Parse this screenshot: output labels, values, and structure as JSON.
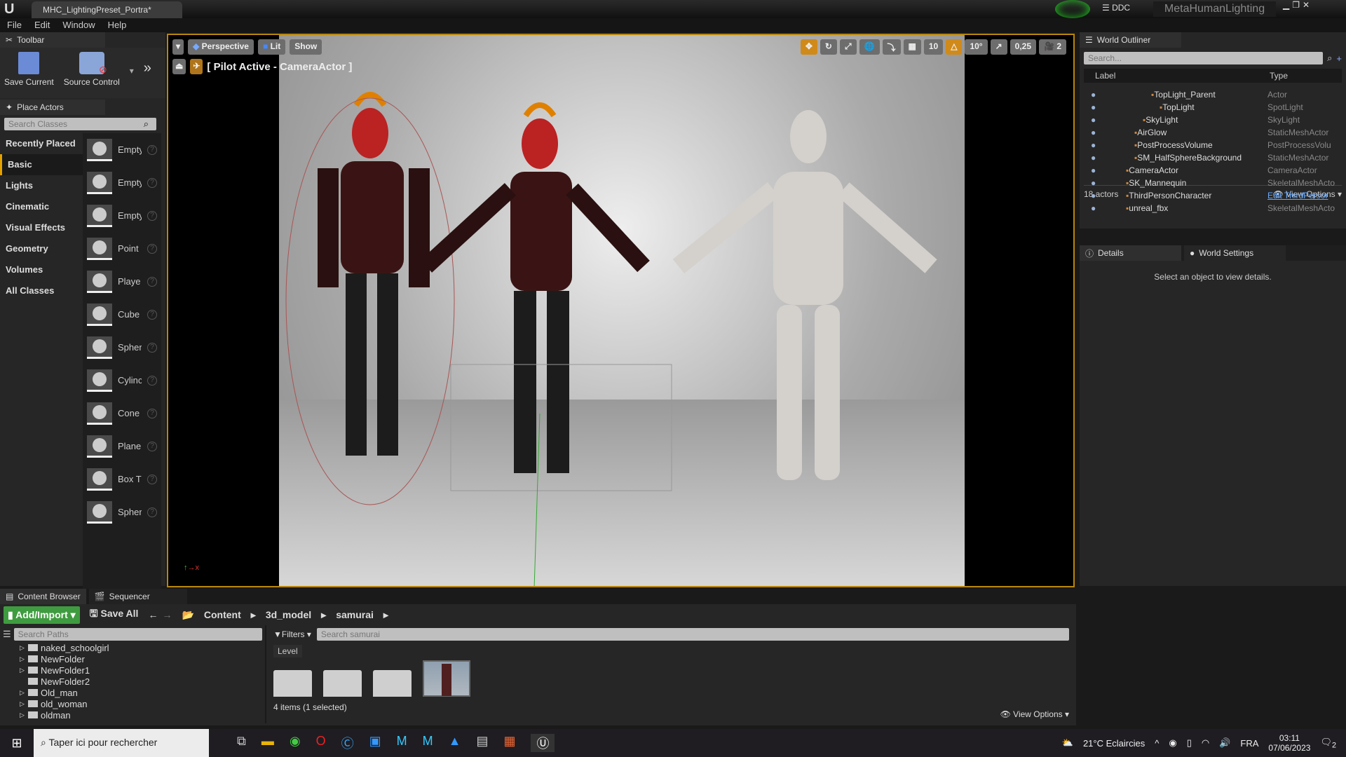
{
  "window": {
    "tab_title": "MHC_LightingPreset_Portra*",
    "ddc_label": "DDC",
    "project_name": "MetaHumanLighting"
  },
  "menu": [
    "File",
    "Edit",
    "Window",
    "Help"
  ],
  "toolbar": {
    "tab": "Toolbar",
    "save": "Save Current",
    "source_control": "Source Control"
  },
  "place_actors": {
    "tab": "Place Actors",
    "search_placeholder": "Search Classes",
    "categories": [
      "Recently Placed",
      "Basic",
      "Lights",
      "Cinematic",
      "Visual Effects",
      "Geometry",
      "Volumes",
      "All Classes"
    ],
    "items": [
      "Empty",
      "Empty",
      "Empty",
      "Point",
      "Playe",
      "Cube",
      "Spher",
      "Cylinc",
      "Cone",
      "Plane",
      "Box T",
      "Spher"
    ]
  },
  "viewport": {
    "view_mode": "Perspective",
    "lit": "Lit",
    "show": "Show",
    "pilot_label": "[ Pilot Active - CameraActor ]",
    "grid_snap": "10",
    "rot_snap": "10°",
    "scale_snap": "0,25",
    "camera_speed": "2"
  },
  "outliner": {
    "tab": "World Outliner",
    "search_placeholder": "Search...",
    "col_label": "Label",
    "col_type": "Type",
    "rows": [
      {
        "label": "TopLight_Parent",
        "type": "Actor",
        "indent": 3
      },
      {
        "label": "TopLight",
        "type": "SpotLight",
        "indent": 4
      },
      {
        "label": "SkyLight",
        "type": "SkyLight",
        "indent": 2
      },
      {
        "label": "AirGlow",
        "type": "StaticMeshActor",
        "indent": 1
      },
      {
        "label": "PostProcessVolume",
        "type": "PostProcessVolu",
        "indent": 1
      },
      {
        "label": "SM_HalfSphereBackground",
        "type": "StaticMeshActor",
        "indent": 1
      },
      {
        "label": "CameraActor",
        "type": "CameraActor",
        "indent": 0
      },
      {
        "label": "SK_Mannequin",
        "type": "SkeletalMeshActo",
        "indent": 0
      },
      {
        "label": "ThirdPersonCharacter",
        "type": "Edit ThirdPersor",
        "indent": 0
      },
      {
        "label": "unreal_fbx",
        "type": "SkeletalMeshActo",
        "indent": 0
      }
    ],
    "count": "18 actors",
    "view_options": "View Options"
  },
  "details": {
    "tab": "Details",
    "world_settings_tab": "World Settings",
    "empty_msg": "Select an object to view details."
  },
  "content_browser": {
    "tab": "Content Browser",
    "sequencer_tab": "Sequencer",
    "add_import": "Add/Import",
    "save_all": "Save All",
    "breadcrumb": [
      "Content",
      "3d_model",
      "samurai"
    ],
    "search_paths_placeholder": "Search Paths",
    "filters": "Filters",
    "search_placeholder": "Search samurai",
    "folders": [
      "naked_schoolgirl",
      "NewFolder",
      "NewFolder1",
      "NewFolder2",
      "Old_man",
      "old_woman",
      "oldman"
    ],
    "filter_chip": "Level",
    "status": "4 items (1 selected)",
    "view_options": "View Options"
  },
  "taskbar": {
    "search_placeholder": "Taper ici pour rechercher",
    "weather": "21°C  Eclaircies",
    "lang": "FRA",
    "time": "03:11",
    "date": "07/06/2023",
    "notif_count": "2"
  }
}
